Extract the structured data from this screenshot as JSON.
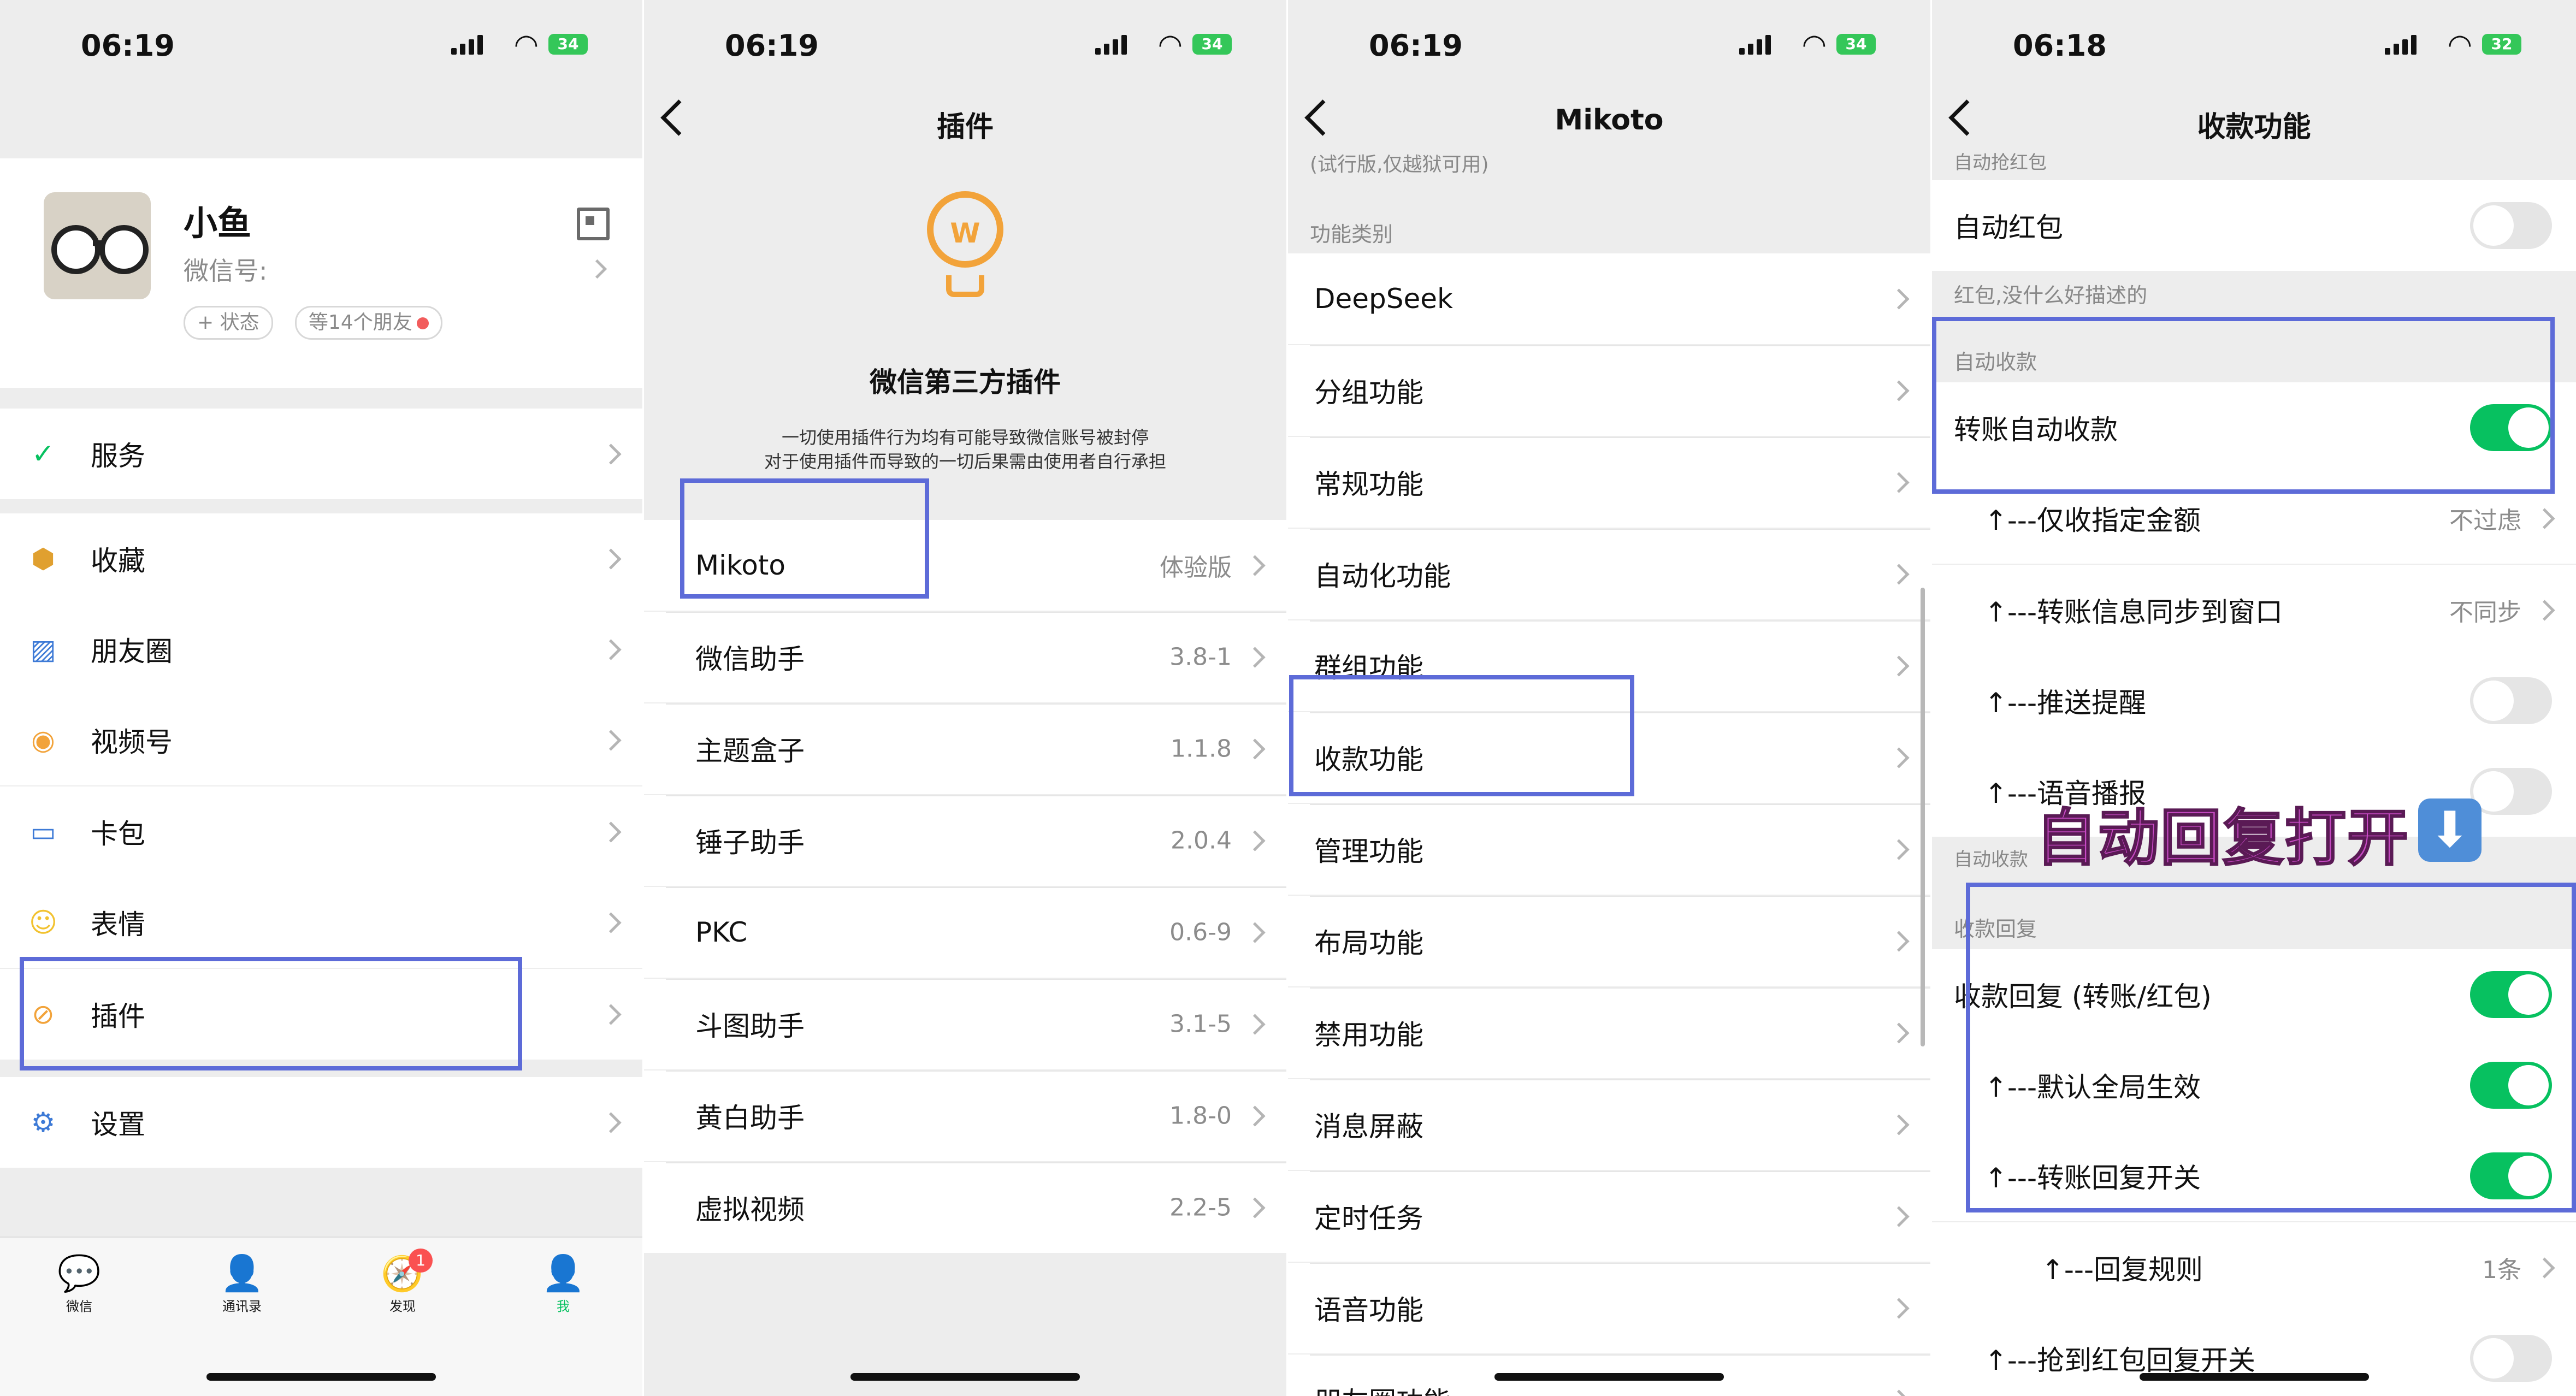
{
  "status_bars": [
    {
      "time": "06:19",
      "battery": "34"
    },
    {
      "time": "06:19",
      "battery": "34"
    },
    {
      "time": "06:19",
      "battery": "34"
    },
    {
      "time": "06:18",
      "battery": "32"
    }
  ],
  "me": {
    "nickname": "小鱼",
    "wechat_id_label": "微信号:",
    "status_pill": "+ 状态",
    "friends_pill": "等14个朋友",
    "menu": [
      {
        "label": "服务",
        "icon": "service-icon",
        "glyph": "✓",
        "color": "#07c160"
      },
      {
        "label": "收藏",
        "icon": "favorites-icon",
        "glyph": "⬢",
        "color": "#e0a030"
      },
      {
        "label": "朋友圈",
        "icon": "moments-icon",
        "glyph": "▨",
        "color": "#3d7ad6"
      },
      {
        "label": "视频号",
        "icon": "channels-icon",
        "glyph": "◉",
        "color": "#f2a33a"
      },
      {
        "label": "卡包",
        "icon": "card-wallet-icon",
        "glyph": "▭",
        "color": "#3d7ad6"
      },
      {
        "label": "表情",
        "icon": "sticker-icon",
        "glyph": "☺",
        "color": "#f2c230"
      },
      {
        "label": "插件",
        "icon": "plugin-icon",
        "glyph": "⊘",
        "color": "#f2a33a"
      },
      {
        "label": "设置",
        "icon": "settings-gear-icon",
        "glyph": "⚙",
        "color": "#3d7ad6"
      }
    ],
    "tabs": [
      {
        "label": "微信",
        "glyph": "💬"
      },
      {
        "label": "通讯录",
        "glyph": "👤"
      },
      {
        "label": "发现",
        "glyph": "🧭",
        "badge": "1"
      },
      {
        "label": "我",
        "glyph": "👤"
      }
    ]
  },
  "plugins": {
    "title": "插件",
    "heading": "微信第三方插件",
    "bulb_text": "W",
    "notice_line1": "一切使用插件行为均有可能导致微信账号被封停",
    "notice_line2": "对于使用插件而导致的一切后果需由使用者自行承担",
    "items": [
      {
        "name": "Mikoto",
        "version": "体验版"
      },
      {
        "name": "微信助手",
        "version": "3.8-1"
      },
      {
        "name": "主题盒子",
        "version": "1.1.8"
      },
      {
        "name": "锤子助手",
        "version": "2.0.4"
      },
      {
        "name": "PKC",
        "version": "0.6-9"
      },
      {
        "name": "斗图助手",
        "version": "3.1-5"
      },
      {
        "name": "黄白助手",
        "version": "1.8-0"
      },
      {
        "name": "虚拟视频",
        "version": "2.2-5"
      }
    ]
  },
  "mikoto": {
    "title": "Mikoto",
    "top_note": "(试行版,仅越狱可用)",
    "section": "功能类别",
    "items": [
      "DeepSeek",
      "分组功能",
      "常规功能",
      "自动化功能",
      "群组功能",
      "收款功能",
      "管理功能",
      "布局功能",
      "禁用功能",
      "消息屏蔽",
      "定时任务",
      "语音功能",
      "朋友圈功能"
    ]
  },
  "payment": {
    "title": "收款功能",
    "top_clipped": "自动抢红包",
    "auto_redpacket": "自动红包",
    "redpacket_note": "红包,没什么好描述的",
    "section_auto_collect": "自动收款",
    "transfer_auto_collect": "转账自动收款",
    "only_amount": "↑---仅收指定金额",
    "only_amount_value": "不过虑",
    "sync_window": "↑---转账信息同步到窗口",
    "sync_window_value": "不同步",
    "push_remind": "↑---推送提醒",
    "voice_broadcast": "↑---语音播报",
    "section_collect_clipped": "自动收款",
    "overlay_caption": "自动回复打开",
    "overlay_arrow": "⬇",
    "section_reply": "收款回复",
    "reply_toggle": "收款回复 (转账/红包)",
    "default_global": "↑---默认全局生效",
    "transfer_reply": "↑---转账回复开关",
    "reply_rules": "↑---回复规则",
    "reply_rules_value": "1条",
    "grab_reply": "↑---抢到红包回复开关"
  }
}
